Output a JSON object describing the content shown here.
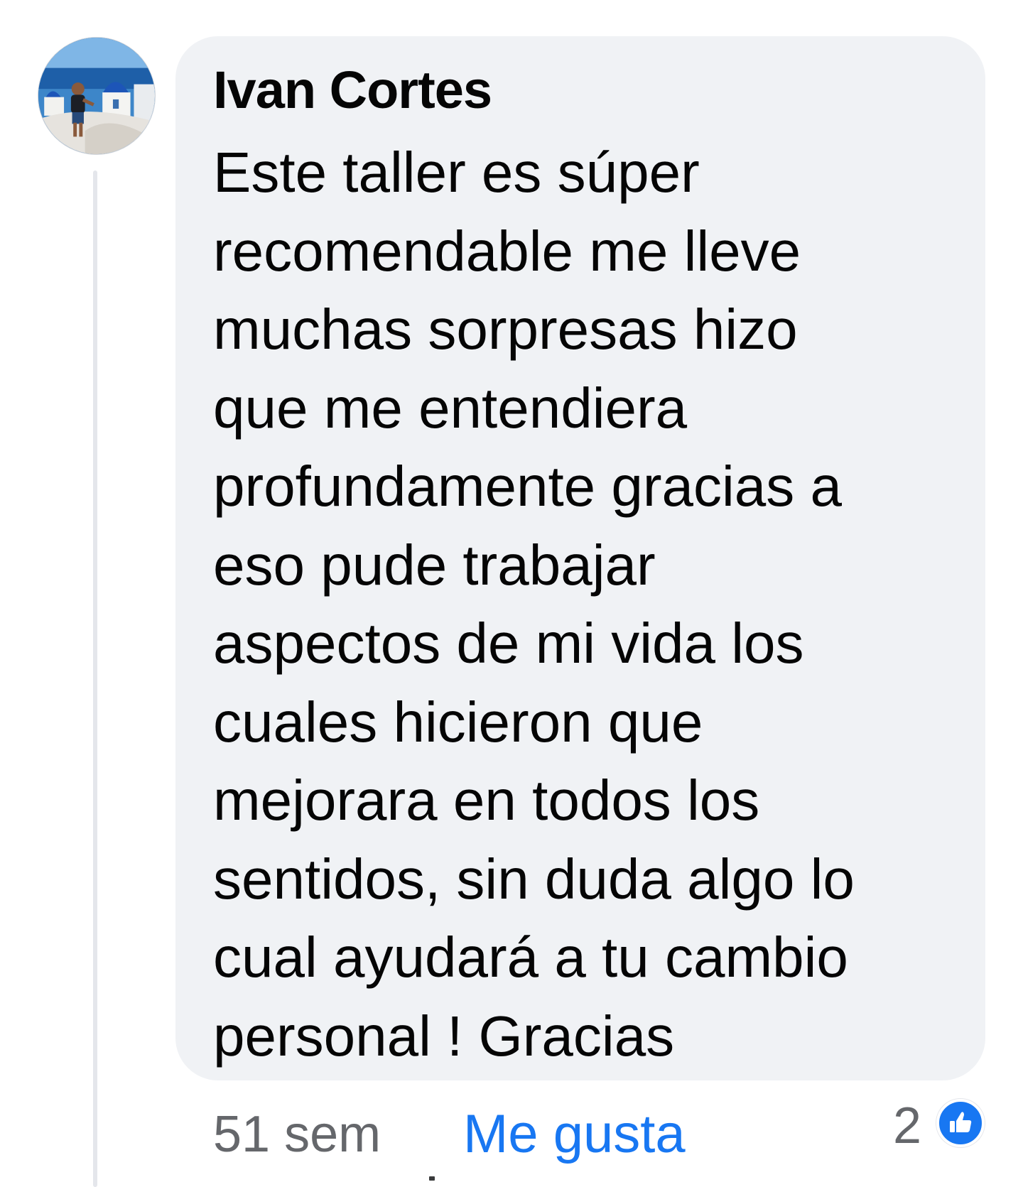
{
  "comment": {
    "author": "Ivan Cortes",
    "avatar_icon": "profile-photo-santorini",
    "lines": [
      "Este taller es súper",
      "recomendable me lleve",
      "muchas sorpresas hizo",
      "que me entendiera",
      "profundamente gracias a",
      "eso pude trabajar",
      "aspectos de mi vida los",
      "cuales hicieron que",
      "mejorara en todos los",
      "sentidos, sin duda algo lo",
      "cual ayudará a tu cambio",
      "personal ! Gracias"
    ],
    "time": "51 sem",
    "like_label": "Me gusta",
    "reaction_count": "2",
    "reaction_icon": "thumbs-up-icon"
  },
  "colors": {
    "bubble": "#f0f2f5",
    "like": "#1877f2",
    "meta": "#65676b",
    "thread_line": "#e4e6eb"
  }
}
